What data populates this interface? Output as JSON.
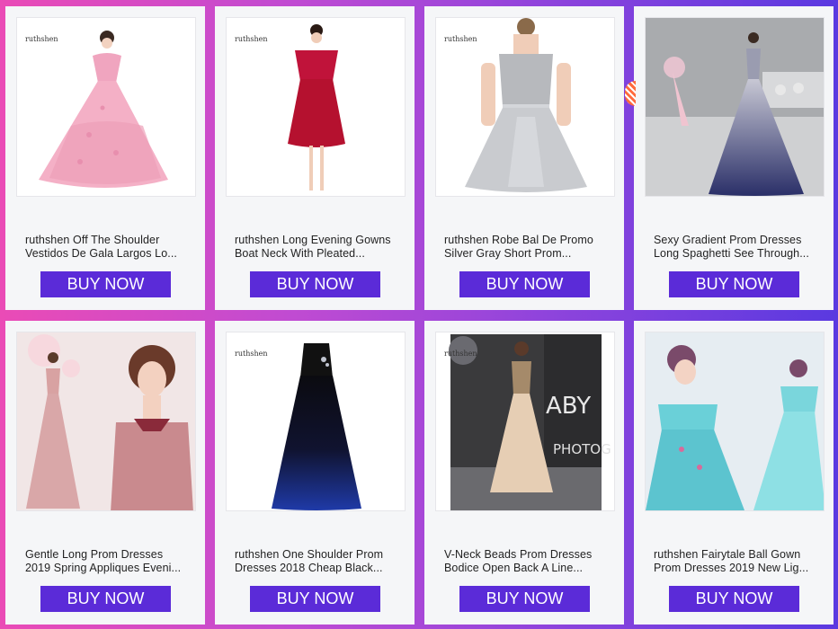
{
  "products": [
    {
      "title_line1": "ruthshen Off The Shoulder",
      "title_line2": "Vestidos De Gala Largos Lo...",
      "button": "BUY NOW",
      "brand": "ruthshen"
    },
    {
      "title_line1": "ruthshen Long Evening Gowns",
      "title_line2": "Boat Neck With Pleated...",
      "button": "BUY NOW",
      "brand": "ruthshen"
    },
    {
      "title_line1": "ruthshen Robe Bal De Promo",
      "title_line2": "Silver Gray Short Prom...",
      "button": "BUY NOW",
      "brand": "ruthshen"
    },
    {
      "title_line1": "Sexy Gradient Prom Dresses",
      "title_line2": "Long Spaghetti See Through...",
      "button": "BUY NOW",
      "brand": ""
    },
    {
      "title_line1": "Gentle Long Prom Dresses",
      "title_line2": "2019 Spring Appliques Eveni...",
      "button": "BUY NOW",
      "brand": ""
    },
    {
      "title_line1": "ruthshen One Shoulder Prom",
      "title_line2": "Dresses 2018 Cheap Black...",
      "button": "BUY NOW",
      "brand": "ruthshen"
    },
    {
      "title_line1": "V-Neck Beads Prom Dresses",
      "title_line2": "Bodice Open Back A Line...",
      "button": "BUY NOW",
      "brand": "ruthshen"
    },
    {
      "title_line1": "ruthshen Fairytale Ball Gown",
      "title_line2": "Prom Dresses 2019 New Lig...",
      "button": "BUY NOW",
      "brand": ""
    }
  ],
  "colors": {
    "button": "#5b2bd8",
    "card": "#f5f6f8"
  }
}
